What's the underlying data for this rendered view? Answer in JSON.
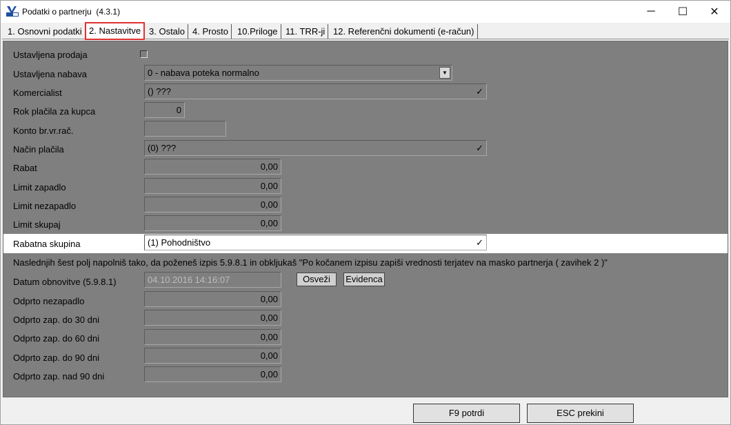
{
  "window": {
    "title": "Podatki o partnerju  (4.3.1)",
    "minimize": "─",
    "maximize": "☐",
    "close": "✕"
  },
  "tabs": [
    {
      "label": "1. Osnovni podatki"
    },
    {
      "label": "2. Nastavitve"
    },
    {
      "label": "3. Ostalo"
    },
    {
      "label": "4. Prosto"
    },
    {
      "label": "10.Priloge"
    },
    {
      "label": "11. TRR-ji"
    },
    {
      "label": "12. Referenčni dokumenti (e-račun)"
    }
  ],
  "form": {
    "ustavljena_prodaja": {
      "label": "Ustavljena prodaja",
      "checked": false
    },
    "ustavljena_nabava": {
      "label": "Ustavljena nabava",
      "value": "0 - nabava poteka normalno"
    },
    "komercialist": {
      "label": "Komercialist",
      "value": "() ???"
    },
    "rok_placila": {
      "label": "Rok plačila za kupca",
      "value": "0"
    },
    "konto": {
      "label": "Konto br.vr.rač.",
      "value": ""
    },
    "nacin_placila": {
      "label": "Način plačila",
      "value": "(0) ???"
    },
    "rabat": {
      "label": "Rabat",
      "value": "0,00"
    },
    "limit_zapadlo": {
      "label": "Limit zapadlo",
      "value": "0,00"
    },
    "limit_nezapadlo": {
      "label": "Limit nezapadlo",
      "value": "0,00"
    },
    "limit_skupaj": {
      "label": "Limit skupaj",
      "value": "0,00"
    },
    "rabatna_skupina": {
      "label": "Rabatna skupina",
      "value": "(1) Pohodništvo"
    },
    "check_glyph": "✓"
  },
  "note": "Naslednjih šest polj napolniš tako, da poženeš izpis 5.9.8.1 in obkljukaš \"Po kočanem izpisu zapiši vrednosti terjatev na masko partnerja ( zavihek 2 )\"",
  "obnova": {
    "datum": {
      "label": "Datum obnovitve (5.9.8.1)",
      "value": "04.10.2016 14:16:07"
    },
    "osvezi_label": "Osveži",
    "evidenca_label": "Evidenca",
    "odprto_nezapadlo": {
      "label": "Odprto nezapadlo",
      "value": "0,00"
    },
    "odprto_30": {
      "label": "Odprto zap. do 30 dni",
      "value": "0,00"
    },
    "odprto_60": {
      "label": "Odprto zap. do 60 dni",
      "value": "0,00"
    },
    "odprto_90": {
      "label": "Odprto zap. do 90 dni",
      "value": "0,00"
    },
    "odprto_nad_90": {
      "label": "Odprto zap. nad 90 dni",
      "value": "0,00"
    }
  },
  "footer": {
    "confirm_label": "F9  potrdi",
    "cancel_label": "ESC  prekini"
  }
}
